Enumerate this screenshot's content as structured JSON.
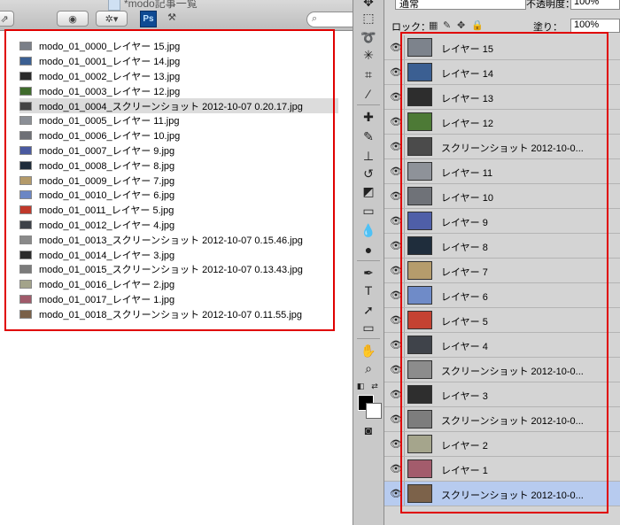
{
  "finder": {
    "window_title": "*modo記事一覧",
    "ps_badge": "Ps",
    "files": [
      {
        "name": "modo_01_0000_レイヤー 15.jpg",
        "thumb": "#7a7f88"
      },
      {
        "name": "modo_01_0001_レイヤー 14.jpg",
        "thumb": "#3b5f92"
      },
      {
        "name": "modo_01_0002_レイヤー 13.jpg",
        "thumb": "#2a2a2a"
      },
      {
        "name": "modo_01_0003_レイヤー 12.jpg",
        "thumb": "#3f6b2c"
      },
      {
        "name": "modo_01_0004_スクリーンショット 2012-10-07 0.20.17.jpg",
        "thumb": "#444444",
        "selected": true
      },
      {
        "name": "modo_01_0005_レイヤー 11.jpg",
        "thumb": "#8b8f96"
      },
      {
        "name": "modo_01_0006_レイヤー 10.jpg",
        "thumb": "#6e7076"
      },
      {
        "name": "modo_01_0007_レイヤー 9.jpg",
        "thumb": "#4a5aa0"
      },
      {
        "name": "modo_01_0008_レイヤー 8.jpg",
        "thumb": "#1e2b3a"
      },
      {
        "name": "modo_01_0009_レイヤー 7.jpg",
        "thumb": "#b49a6a"
      },
      {
        "name": "modo_01_0010_レイヤー 6.jpg",
        "thumb": "#6b86c4"
      },
      {
        "name": "modo_01_0011_レイヤー 5.jpg",
        "thumb": "#c0392b"
      },
      {
        "name": "modo_01_0012_レイヤー 4.jpg",
        "thumb": "#3d4148"
      },
      {
        "name": "modo_01_0013_スクリーンショット 2012-10-07 0.15.46.jpg",
        "thumb": "#8a8a8a"
      },
      {
        "name": "modo_01_0014_レイヤー 3.jpg",
        "thumb": "#2b2b2b"
      },
      {
        "name": "modo_01_0015_スクリーンショット 2012-10-07 0.13.43.jpg",
        "thumb": "#7b7b7b"
      },
      {
        "name": "modo_01_0016_レイヤー 2.jpg",
        "thumb": "#a3a38a"
      },
      {
        "name": "modo_01_0017_レイヤー 1.jpg",
        "thumb": "#a05a6a"
      },
      {
        "name": "modo_01_0018_スクリーンショット 2012-10-07 0.11.55.jpg",
        "thumb": "#7a6048"
      }
    ]
  },
  "layers_panel": {
    "blend_mode": "通常",
    "opacity_label": "不透明度：",
    "opacity_value": "100%",
    "lock_label": "ロック：",
    "fill_label": "塗り：",
    "fill_value": "100%",
    "layers": [
      {
        "name": "レイヤー 15",
        "thumb": "#7d838c"
      },
      {
        "name": "レイヤー 14",
        "thumb": "#3b5f92"
      },
      {
        "name": "レイヤー 13",
        "thumb": "#2d2d2d"
      },
      {
        "name": "レイヤー 12",
        "thumb": "#4d7a36"
      },
      {
        "name": "スクリーンショット 2012-10-0...",
        "thumb": "#4b4b4b"
      },
      {
        "name": "レイヤー 11",
        "thumb": "#8e9299"
      },
      {
        "name": "レイヤー 10",
        "thumb": "#6f7278"
      },
      {
        "name": "レイヤー 9",
        "thumb": "#4f5fa8"
      },
      {
        "name": "レイヤー 8",
        "thumb": "#1f2d3c"
      },
      {
        "name": "レイヤー 7",
        "thumb": "#b59c6c"
      },
      {
        "name": "レイヤー 6",
        "thumb": "#6f8bc8"
      },
      {
        "name": "レイヤー 5",
        "thumb": "#c44232"
      },
      {
        "name": "レイヤー 4",
        "thumb": "#3f434a"
      },
      {
        "name": "スクリーンショット 2012-10-0...",
        "thumb": "#8c8c8c"
      },
      {
        "name": "レイヤー 3",
        "thumb": "#2e2e2e"
      },
      {
        "name": "スクリーンショット 2012-10-0...",
        "thumb": "#7d7d7d"
      },
      {
        "name": "レイヤー 2",
        "thumb": "#a5a58c"
      },
      {
        "name": "レイヤー 1",
        "thumb": "#a35c6c"
      },
      {
        "name": "スクリーンショット 2012-10-0...",
        "thumb": "#7c624a",
        "selected": true
      }
    ]
  },
  "colors": {
    "highlight_box": "#e00000",
    "selected_layer": "#b7cbef",
    "panel_bg": "#d4d4d4"
  }
}
